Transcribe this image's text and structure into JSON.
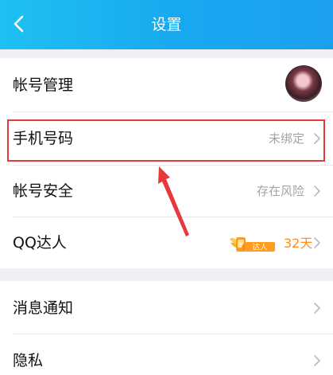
{
  "header": {
    "title": "设置"
  },
  "account_group": {
    "items": [
      {
        "label": "帐号管理"
      },
      {
        "label": "手机号码",
        "value": "未绑定"
      },
      {
        "label": "帐号安全",
        "value": "存在风险"
      },
      {
        "label": "QQ达人",
        "badge_text": "达人",
        "days": "32天"
      }
    ]
  },
  "other_group": {
    "items": [
      {
        "label": "消息通知"
      },
      {
        "label": "隐私"
      }
    ]
  },
  "annotation": {
    "highlight_color": "#e5393b"
  },
  "theme": {
    "header_color": "#18a8f0",
    "accent_orange": "#ff8b22"
  },
  "icons": [
    "back-arrow-icon",
    "chevron-right-icon",
    "avatar",
    "qq-daren-badge-icon",
    "red-annotation-arrow"
  ]
}
